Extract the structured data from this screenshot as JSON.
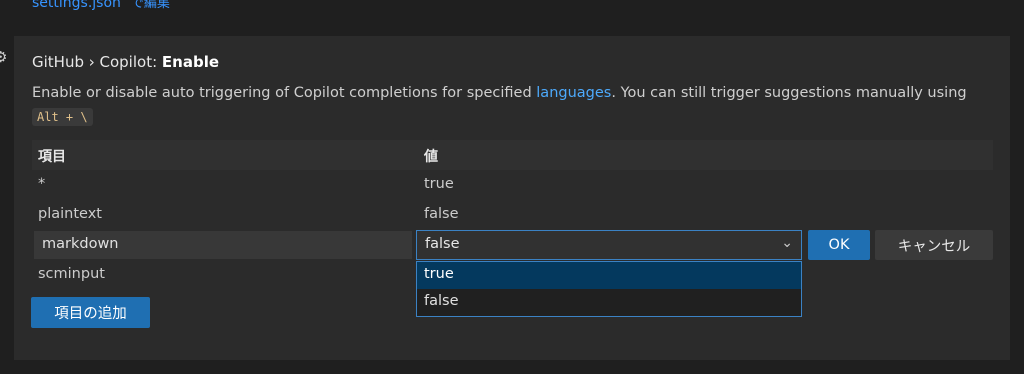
{
  "top": {
    "file_link": "settings.json",
    "edit_label": "で編集"
  },
  "setting": {
    "category": "GitHub › Copilot: ",
    "name": "Enable",
    "description_pre": "Enable or disable auto triggering of Copilot completions for specified ",
    "description_link": "languages",
    "description_post": ". You can still trigger suggestions manually using ",
    "shortcut": "Alt + \\"
  },
  "table": {
    "headers": {
      "key": "項目",
      "value": "値"
    },
    "rows": [
      {
        "key": "*",
        "value": "true"
      },
      {
        "key": "plaintext",
        "value": "false"
      }
    ],
    "editing": {
      "key": "markdown",
      "value": "false"
    },
    "after_rows": [
      {
        "key": "scminput",
        "value": ""
      }
    ]
  },
  "buttons": {
    "ok": "OK",
    "cancel": "キャンセル",
    "add": "項目の追加"
  },
  "dropdown": {
    "options": [
      "true",
      "false"
    ],
    "highlighted": "true"
  },
  "colors": {
    "accent": "#1f6fb2",
    "link": "#4daafc",
    "focus_border": "#3b82c4"
  }
}
